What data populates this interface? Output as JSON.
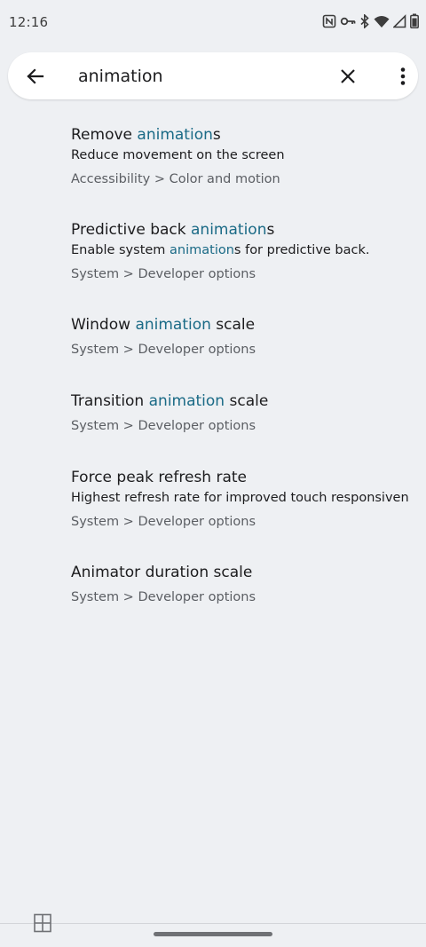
{
  "status_bar": {
    "time": "12:16",
    "icons": [
      "nfc-icon",
      "vpn-key-icon",
      "bluetooth-icon",
      "wifi-icon",
      "signal-icon",
      "battery-icon"
    ]
  },
  "search": {
    "query": "animation",
    "back_icon": "arrow-back-icon",
    "clear_icon": "close-icon",
    "more_icon": "more-vert-icon"
  },
  "results": [
    {
      "title_parts": [
        "Remove ",
        "animation",
        "s"
      ],
      "summary_parts": [
        "Reduce movement on the screen",
        "",
        ""
      ],
      "path": "Accessibility > Color and motion"
    },
    {
      "title_parts": [
        "Predictive back ",
        "animation",
        "s"
      ],
      "summary_parts": [
        "Enable system ",
        "animation",
        "s for predictive back."
      ],
      "path": "System > Developer options"
    },
    {
      "title_parts": [
        "Window ",
        "animation",
        " scale"
      ],
      "path": "System > Developer options"
    },
    {
      "title_parts": [
        "Transition ",
        "animation",
        " scale"
      ],
      "path": "System > Developer options"
    },
    {
      "title_parts": [
        "Force peak refresh rate",
        "",
        ""
      ],
      "summary_parts": [
        "Highest refresh rate for improved touch responsiven..",
        "",
        ""
      ],
      "path": "System > Developer options"
    },
    {
      "title_parts": [
        "Animator duration scale",
        "",
        ""
      ],
      "path": "System > Developer options"
    }
  ],
  "nav": {
    "left_icon": "view-grid-icon"
  },
  "colors": {
    "background": "#eef0f3",
    "highlight": "#1a6a86",
    "secondary_text": "#5b5e63"
  }
}
